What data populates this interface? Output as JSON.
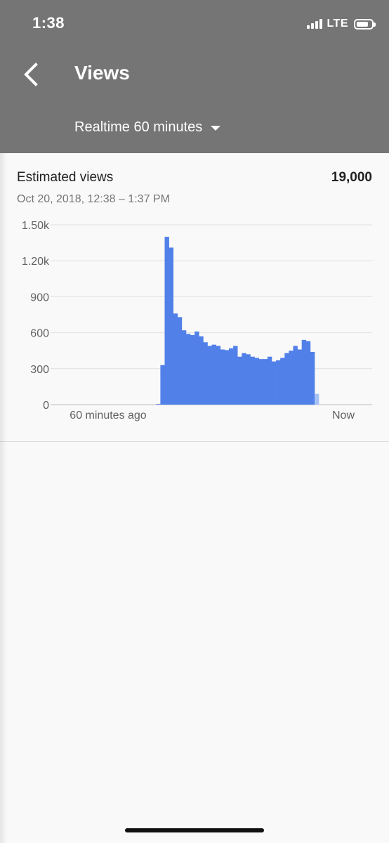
{
  "status_bar": {
    "time": "1:38",
    "network": "LTE"
  },
  "header": {
    "back_icon": "chevron-left-icon",
    "title": "Views",
    "range_label": "Realtime 60 minutes"
  },
  "card": {
    "metric_label": "Estimated views",
    "metric_value": "19,000",
    "date_range": "Oct 20, 2018, 12:38 – 1:37 PM"
  },
  "colors": {
    "header_bg": "#757575",
    "bar": "#5080e8",
    "bar_current": "#a8c1f4",
    "grid": "#e0e0e0"
  },
  "chart_data": {
    "type": "bar",
    "title": "",
    "xlabel": "",
    "ylabel": "",
    "ylim": [
      0,
      1500
    ],
    "y_ticks": [
      0,
      300,
      600,
      900,
      1200,
      1500
    ],
    "y_tick_labels": [
      "0",
      "300",
      "600",
      "900",
      "1.20k",
      "1.50k"
    ],
    "x_tick_labels": [
      "60 minutes ago",
      "Now"
    ],
    "grid": true,
    "series": [
      {
        "values": [
          0,
          0,
          0,
          0,
          0,
          0,
          0,
          0,
          0,
          0,
          0,
          0,
          0,
          0,
          0,
          0,
          0,
          0,
          0,
          0,
          0,
          0,
          0,
          5,
          330,
          1400,
          1310,
          760,
          730,
          620,
          590,
          580,
          610,
          570,
          520,
          490,
          500,
          490,
          460,
          455,
          470,
          490,
          400,
          430,
          420,
          400,
          390,
          380,
          380,
          400,
          360,
          370,
          390,
          430,
          450,
          490,
          460,
          540,
          530,
          440,
          90
        ]
      }
    ],
    "current_index": 60
  }
}
